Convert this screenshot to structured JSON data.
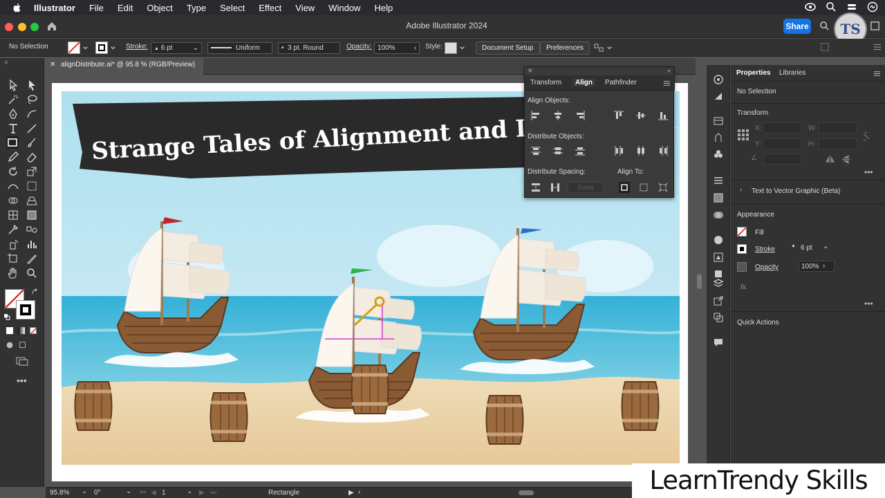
{
  "menubar": {
    "app": "Illustrator",
    "items": [
      "File",
      "Edit",
      "Object",
      "Type",
      "Select",
      "Effect",
      "View",
      "Window",
      "Help"
    ]
  },
  "window": {
    "title": "Adobe Illustrator 2024",
    "share": "Share"
  },
  "controlbar": {
    "selection": "No Selection",
    "stroke_label": "Stroke:",
    "stroke_value": "6 pt",
    "profile": "Uniform",
    "brush": "3 pt. Round",
    "opacity_label": "Opacity:",
    "opacity_value": "100%",
    "style_label": "Style:",
    "doc_setup": "Document Setup",
    "preferences": "Preferences"
  },
  "document": {
    "tab": "alignDistribute.ai* @ 95.8 % (RGB/Preview)"
  },
  "artwork": {
    "banner_text": "Strange Tales of Alignment and Distribution",
    "colors": {
      "sky": "#bfe3f0",
      "sea": "#3fb4d6",
      "sand": "#e9d2a6",
      "banner": "#2a2a2a",
      "wood": "#8a5a34"
    },
    "flag_colors": [
      "#c0252a",
      "#2db34a",
      "#2a6fc4"
    ]
  },
  "align_panel": {
    "tabs": [
      "Transform",
      "Align",
      "Pathfinder"
    ],
    "active_tab": "Align",
    "align_objects": "Align Objects:",
    "distribute_objects": "Distribute Objects:",
    "distribute_spacing": "Distribute Spacing:",
    "align_to": "Align To:",
    "spacing_placeholder": "0 mm"
  },
  "properties": {
    "tabs": [
      "Properties",
      "Libraries"
    ],
    "selection": "No Selection",
    "transform": "Transform",
    "x_label": "X:",
    "y_label": "Y:",
    "w_label": "W:",
    "h_label": "H:",
    "text_to_vector": "Text to Vector Graphic (Beta)",
    "appearance": "Appearance",
    "fill": "Fill",
    "stroke": "Stroke",
    "stroke_value": "6 pt",
    "opacity": "Opacity",
    "opacity_value": "100%",
    "fx": "fx.",
    "quick_actions": "Quick Actions"
  },
  "status": {
    "zoom": "95.8%",
    "rotation": "0°",
    "artboard": "1",
    "tool": "Rectangle"
  },
  "watermark": "LearnTrendy Skills",
  "logo": "TS"
}
